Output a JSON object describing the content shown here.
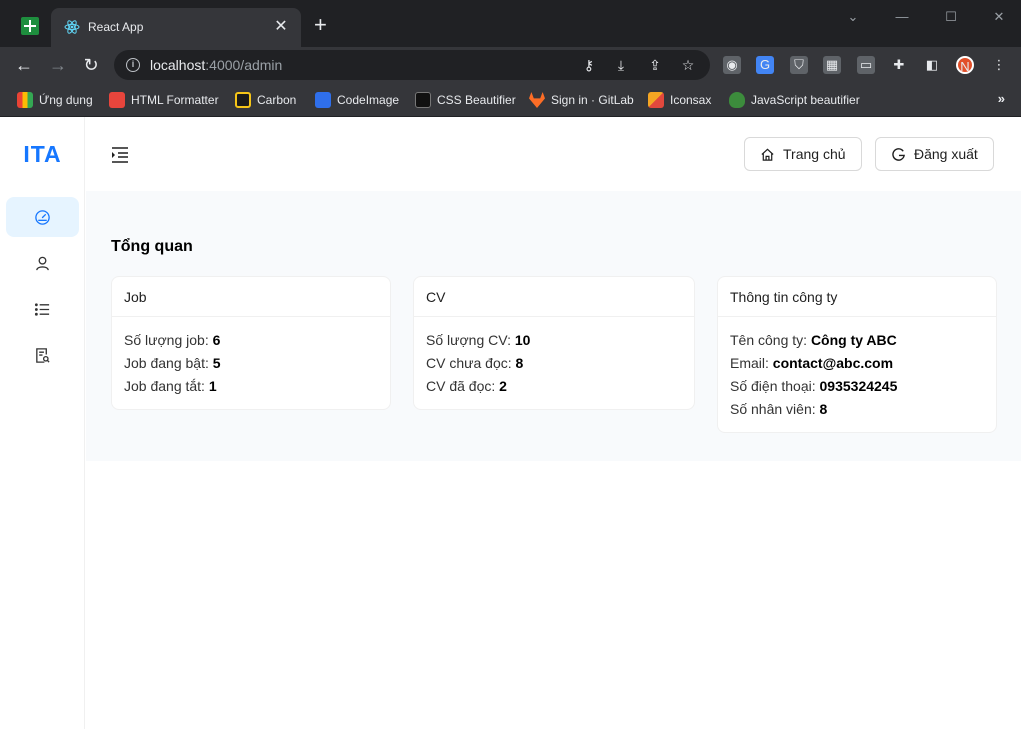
{
  "browser": {
    "tab_title": "React App",
    "url_host": "localhost",
    "url_path": ":4000/admin",
    "bookmarks": [
      {
        "label": "Ứng dụng",
        "color": "#e94235"
      },
      {
        "label": "HTML Formatter",
        "color": "#e8453c"
      },
      {
        "label": "Carbon",
        "color": "#f5c518"
      },
      {
        "label": "CodeImage",
        "color": "#2f6feb"
      },
      {
        "label": "CSS Beautifier",
        "color": "#111111"
      },
      {
        "label": "Sign in · GitLab",
        "color": "#fc6d26"
      },
      {
        "label": "Iconsax",
        "color": "#e2483d"
      },
      {
        "label": "JavaScript beautifier",
        "color": "#3c8c3c"
      }
    ],
    "bookmarks_more": "»"
  },
  "app": {
    "logo": "ITA",
    "accent": "#1677ff",
    "header": {
      "home_label": "Trang chủ",
      "logout_label": "Đăng xuất"
    },
    "section_title": "Tổng quan",
    "cards": {
      "job": {
        "title": "Job",
        "rows": [
          {
            "label": "Số lượng job: ",
            "value": "6"
          },
          {
            "label": "Job đang bật: ",
            "value": "5"
          },
          {
            "label": "Job đang tắt: ",
            "value": "1"
          }
        ]
      },
      "cv": {
        "title": "CV",
        "rows": [
          {
            "label": "Số lượng CV: ",
            "value": "10"
          },
          {
            "label": "CV chưa đọc: ",
            "value": "8"
          },
          {
            "label": "CV đã đọc: ",
            "value": "2"
          }
        ]
      },
      "company": {
        "title": "Thông tin công ty",
        "rows": [
          {
            "label": "Tên công ty: ",
            "value": "Công ty ABC"
          },
          {
            "label": "Email: ",
            "value": "contact@abc.com"
          },
          {
            "label": "Số điện thoại: ",
            "value": "0935324245"
          },
          {
            "label": "Số nhân viên: ",
            "value": "8"
          }
        ]
      }
    }
  }
}
